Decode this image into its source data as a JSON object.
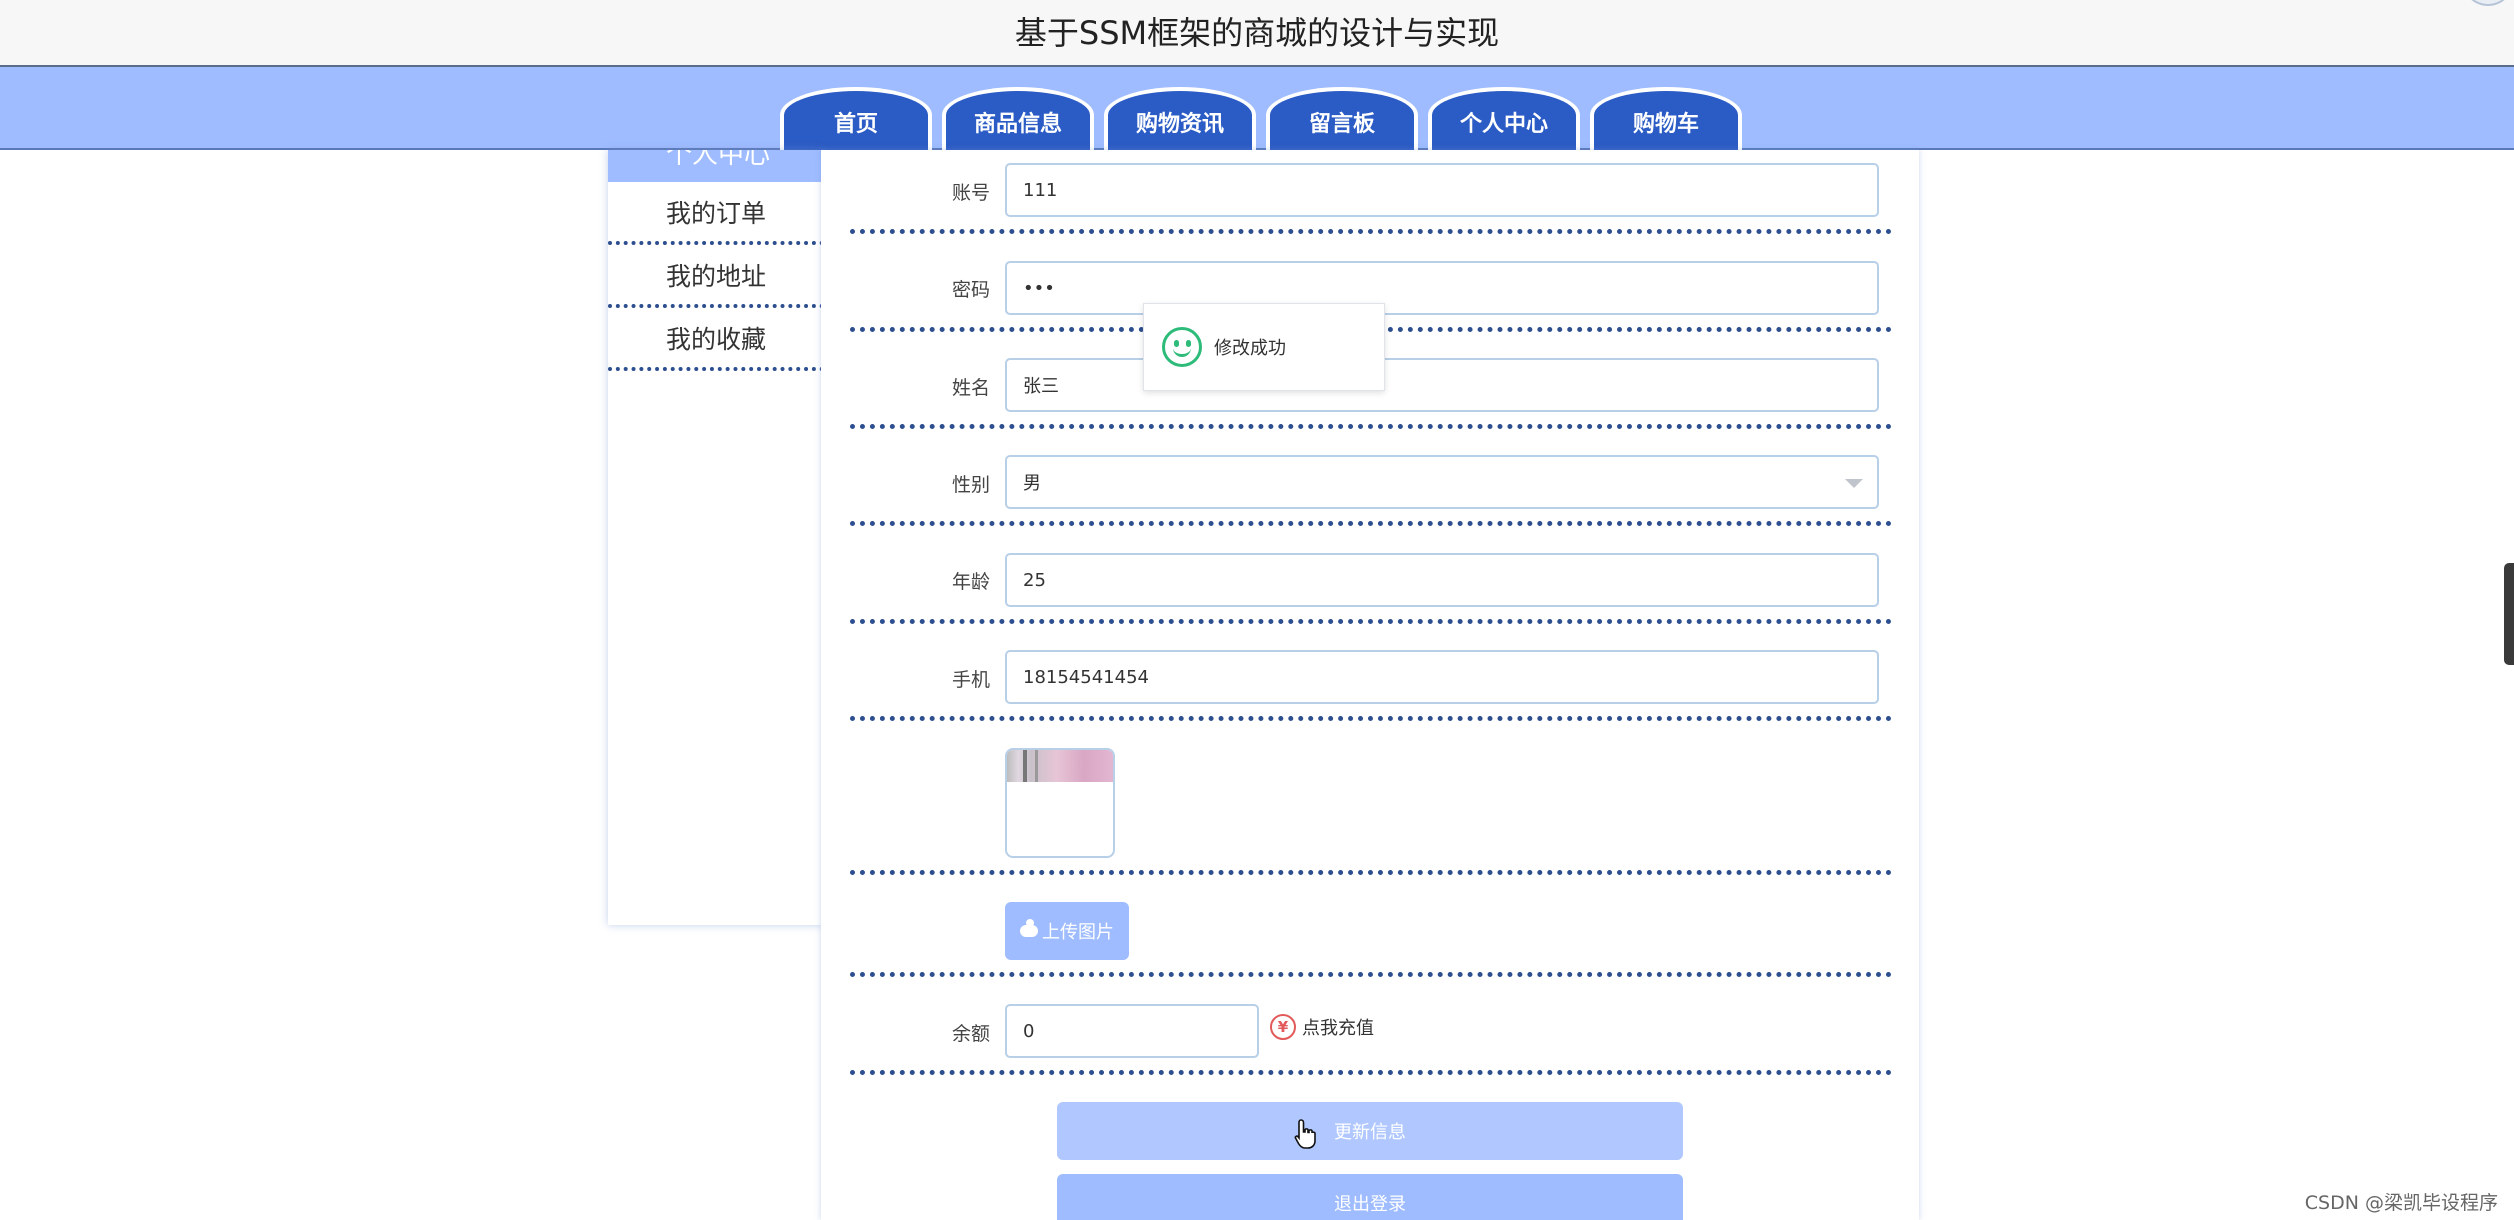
{
  "header": {
    "title": "基于SSM框架的商城的设计与实现"
  },
  "nav": {
    "tabs": [
      {
        "label": "首页"
      },
      {
        "label": "商品信息"
      },
      {
        "label": "购物资讯"
      },
      {
        "label": "留言板"
      },
      {
        "label": "个人中心"
      },
      {
        "label": "购物车"
      }
    ]
  },
  "sidebar": {
    "header": "个人中心",
    "items": [
      {
        "label": "我的订单"
      },
      {
        "label": "我的地址"
      },
      {
        "label": "我的收藏"
      }
    ]
  },
  "form": {
    "account": {
      "label": "账号",
      "value": "111"
    },
    "password": {
      "label": "密码",
      "value": "•••"
    },
    "name": {
      "label": "姓名",
      "value": "张三"
    },
    "gender": {
      "label": "性别",
      "value": "男"
    },
    "age": {
      "label": "年龄",
      "value": "25"
    },
    "phone": {
      "label": "手机",
      "value": "18154541454"
    },
    "upload_label": "上传图片",
    "balance": {
      "label": "余额",
      "value": "0"
    },
    "recharge_label": "点我充值",
    "recharge_icon_text": "¥",
    "update_label": "更新信息",
    "logout_label": "退出登录"
  },
  "toast": {
    "message": "修改成功"
  },
  "watermark": "CSDN @梁凯毕设程序",
  "colors": {
    "nav_bg": "#9ebcff",
    "tab_bg": "#2b5bc4",
    "divider": "#2d4f8f",
    "button": "#9ebcff",
    "success": "#2dbb7a"
  }
}
